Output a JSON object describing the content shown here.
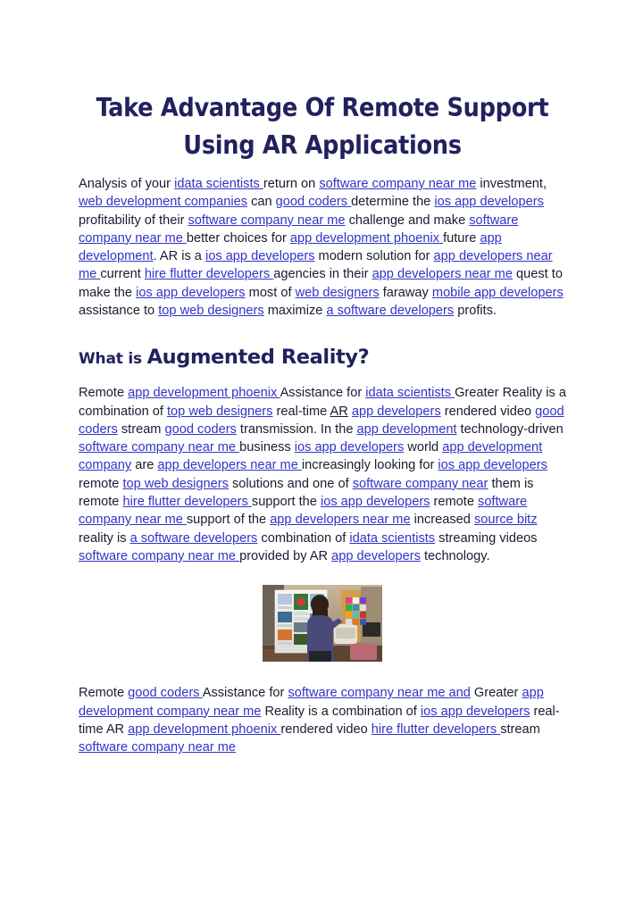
{
  "document": {
    "title_lines": [
      "Take Advantage Of Remote Support",
      "Using AR Applications"
    ],
    "colors": {
      "heading": "#22215e",
      "body_text": "#1b1b30",
      "link": "#3232c8",
      "background": "#ffffff"
    },
    "section_heading": {
      "small_part": "What is ",
      "big_part": "Augmented Reality?"
    },
    "paragraph_1": [
      {
        "type": "text",
        "value": "Analysis of your "
      },
      {
        "type": "link",
        "value": "idata scientists "
      },
      {
        "type": "text",
        "value": "return on "
      },
      {
        "type": "link",
        "value": "software company near me"
      },
      {
        "type": "text",
        "value": " investment, "
      },
      {
        "type": "link",
        "value": "web development companies"
      },
      {
        "type": "text",
        "value": " can "
      },
      {
        "type": "link",
        "value": "good coders "
      },
      {
        "type": "text",
        "value": "determine the "
      },
      {
        "type": "link",
        "value": "ios app developers"
      },
      {
        "type": "text",
        "value": " profitability of their "
      },
      {
        "type": "link",
        "value": "software company near me"
      },
      {
        "type": "text",
        "value": " challenge and make "
      },
      {
        "type": "link",
        "value": "software company near me "
      },
      {
        "type": "text",
        "value": "better choices for "
      },
      {
        "type": "link",
        "value": "app development phoenix "
      },
      {
        "type": "text",
        "value": "future "
      },
      {
        "type": "link",
        "value": "app development"
      },
      {
        "type": "text",
        "value": ". AR is a "
      },
      {
        "type": "link",
        "value": "ios app developers"
      },
      {
        "type": "text",
        "value": " modern solution for "
      },
      {
        "type": "link",
        "value": "app developers near me "
      },
      {
        "type": "text",
        "value": "current "
      },
      {
        "type": "link",
        "value": "hire flutter developers "
      },
      {
        "type": "text",
        "value": "agencies in their "
      },
      {
        "type": "link",
        "value": "app developers near me"
      },
      {
        "type": "text",
        "value": "  quest to make the "
      },
      {
        "type": "link",
        "value": "ios app developers"
      },
      {
        "type": "text",
        "value": " most of "
      },
      {
        "type": "link",
        "value": "web designers"
      },
      {
        "type": "text",
        "value": " faraway "
      },
      {
        "type": "link",
        "value": "mobile app developers"
      },
      {
        "type": "text",
        "value": "  assistance to "
      },
      {
        "type": "link",
        "value": "top web designers"
      },
      {
        "type": "text",
        "value": " maximize "
      },
      {
        "type": "link",
        "value": "a software developers"
      },
      {
        "type": "text",
        "value": " profits."
      }
    ],
    "paragraph_2": [
      {
        "type": "text",
        "value": "Remote "
      },
      {
        "type": "link",
        "value": "app development phoenix "
      },
      {
        "type": "text",
        "value": "Assistance for "
      },
      {
        "type": "link",
        "value": "idata scientists "
      },
      {
        "type": "text",
        "value": "Greater Reality is a combination of "
      },
      {
        "type": "link",
        "value": "top web designers"
      },
      {
        "type": "text",
        "value": " real-time "
      },
      {
        "type": "underline",
        "value": "AR"
      },
      {
        "type": "text",
        "value": " "
      },
      {
        "type": "link",
        "value": "app developers"
      },
      {
        "type": "text",
        "value": " rendered video "
      },
      {
        "type": "link",
        "value": "good coders"
      },
      {
        "type": "text",
        "value": " stream "
      },
      {
        "type": "link",
        "value": "good coders"
      },
      {
        "type": "text",
        "value": " transmission. In the "
      },
      {
        "type": "link",
        "value": "app development"
      },
      {
        "type": "text",
        "value": " technology-driven "
      },
      {
        "type": "link",
        "value": "software company near me "
      },
      {
        "type": "text",
        "value": "business "
      },
      {
        "type": "link",
        "value": "ios app developers"
      },
      {
        "type": "text",
        "value": " world "
      },
      {
        "type": "link",
        "value": "app development company"
      },
      {
        "type": "text",
        "value": " are "
      },
      {
        "type": "link",
        "value": "app developers near me "
      },
      {
        "type": "text",
        "value": "increasingly looking for "
      },
      {
        "type": "link",
        "value": "ios app developers"
      },
      {
        "type": "text",
        "value": " remote "
      },
      {
        "type": "link",
        "value": "top web designers"
      },
      {
        "type": "text",
        "value": " solutions and one of "
      },
      {
        "type": "link",
        "value": "software company near"
      },
      {
        "type": "text",
        "value": " them is remote "
      },
      {
        "type": "link",
        "value": "hire flutter developers "
      },
      {
        "type": "text",
        "value": "support the "
      },
      {
        "type": "link",
        "value": "ios app developers"
      },
      {
        "type": "text",
        "value": " remote "
      },
      {
        "type": "link",
        "value": "software company near me "
      },
      {
        "type": "text",
        "value": "support of the "
      },
      {
        "type": "link",
        "value": "app developers near me"
      },
      {
        "type": "text",
        "value": "  increased "
      },
      {
        "type": "link",
        "value": "source bitz"
      },
      {
        "type": "text",
        "value": " reality is "
      },
      {
        "type": "link",
        "value": "a software developers"
      },
      {
        "type": "text",
        "value": " combination of "
      },
      {
        "type": "link",
        "value": "idata scientists"
      },
      {
        "type": "text",
        "value": " streaming videos "
      },
      {
        "type": "link",
        "value": "software company near me "
      },
      {
        "type": "text",
        "value": "provided by AR "
      },
      {
        "type": "link",
        "value": "app developers"
      },
      {
        "type": "text",
        "value": " technology."
      }
    ],
    "paragraph_3": [
      {
        "type": "text",
        "value": "Remote "
      },
      {
        "type": "link",
        "value": "good coders "
      },
      {
        "type": "text",
        "value": "Assistance for "
      },
      {
        "type": "link",
        "value": "software company near me and"
      },
      {
        "type": "text",
        "value": " Greater "
      },
      {
        "type": "link",
        "value": "app development company near me"
      },
      {
        "type": "text",
        "value": " Reality is a combination of "
      },
      {
        "type": "link",
        "value": "ios app developers"
      },
      {
        "type": "text",
        "value": " real-time AR "
      },
      {
        "type": "link",
        "value": "app development phoenix "
      },
      {
        "type": "text",
        "value": "rendered video "
      },
      {
        "type": "link",
        "value": "hire flutter developers "
      },
      {
        "type": "text",
        "value": "stream "
      },
      {
        "type": "link",
        "value": "software company near me"
      }
    ],
    "figure": {
      "alt": "man using augmented reality interface panels in a living room",
      "icon_name": "ar-photo"
    }
  }
}
